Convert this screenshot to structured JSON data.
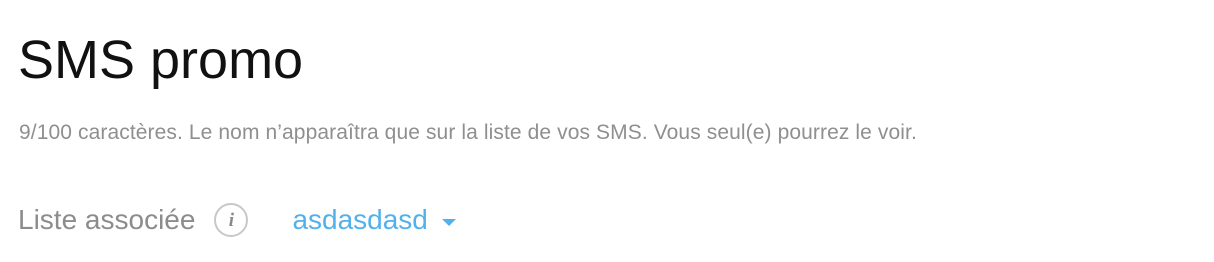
{
  "header": {
    "title": "SMS promo"
  },
  "name_field": {
    "helper_text": "9/100 caractères. Le nom n’apparaîtra que sur la liste de vos SMS. Vous seul(e) pourrez le voir."
  },
  "associated_list": {
    "label": "Liste associée",
    "info_icon": "info-icon",
    "info_glyph": "i",
    "selected_value": "asdasdasd",
    "dropdown_icon": "caret-down-icon"
  },
  "colors": {
    "accent": "#52b1ea",
    "title_text": "#111111",
    "muted_text": "#8f8f8f"
  }
}
